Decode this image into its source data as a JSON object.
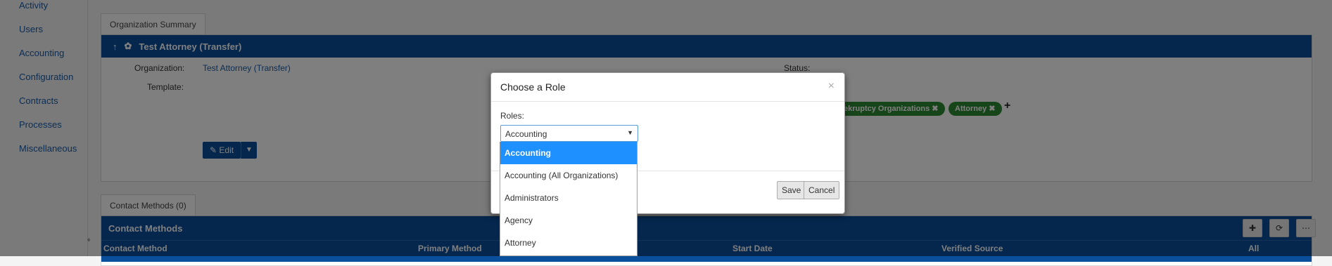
{
  "sidebar": {
    "items": [
      {
        "label": "Activity"
      },
      {
        "label": "Users"
      },
      {
        "label": "Accounting"
      },
      {
        "label": "Configuration"
      },
      {
        "label": "Contracts"
      },
      {
        "label": "Processes"
      },
      {
        "label": "Miscellaneous"
      }
    ],
    "collapse_glyph": "«"
  },
  "summary": {
    "tab_label": "Organization Summary",
    "header_title": "Test Attorney (Transfer)",
    "organization_label": "Organization:",
    "organization_value": "Test Attorney (Transfer)",
    "template_label": "Template:",
    "status_label": "Status:",
    "roles": [
      "ekruptcy Organizations ✖",
      "Attorney ✖"
    ],
    "add_role_glyph": "+",
    "edit_label": "✎ Edit"
  },
  "contacts": {
    "tab_label": "Contact Methods (0)",
    "header_title": "Contact Methods",
    "columns": [
      "Contact Method",
      "Primary Method",
      "Start Date",
      "Verified Source",
      "All"
    ]
  },
  "modal": {
    "title": "Choose a Role",
    "close_glyph": "×",
    "roles_label": "Roles:",
    "selected_role": "Accounting",
    "options": [
      "Accounting",
      "Accounting (All Organizations)",
      "Administrators",
      "Agency",
      "Attorney"
    ],
    "save_label": "Save",
    "cancel_label": "Cancel"
  }
}
